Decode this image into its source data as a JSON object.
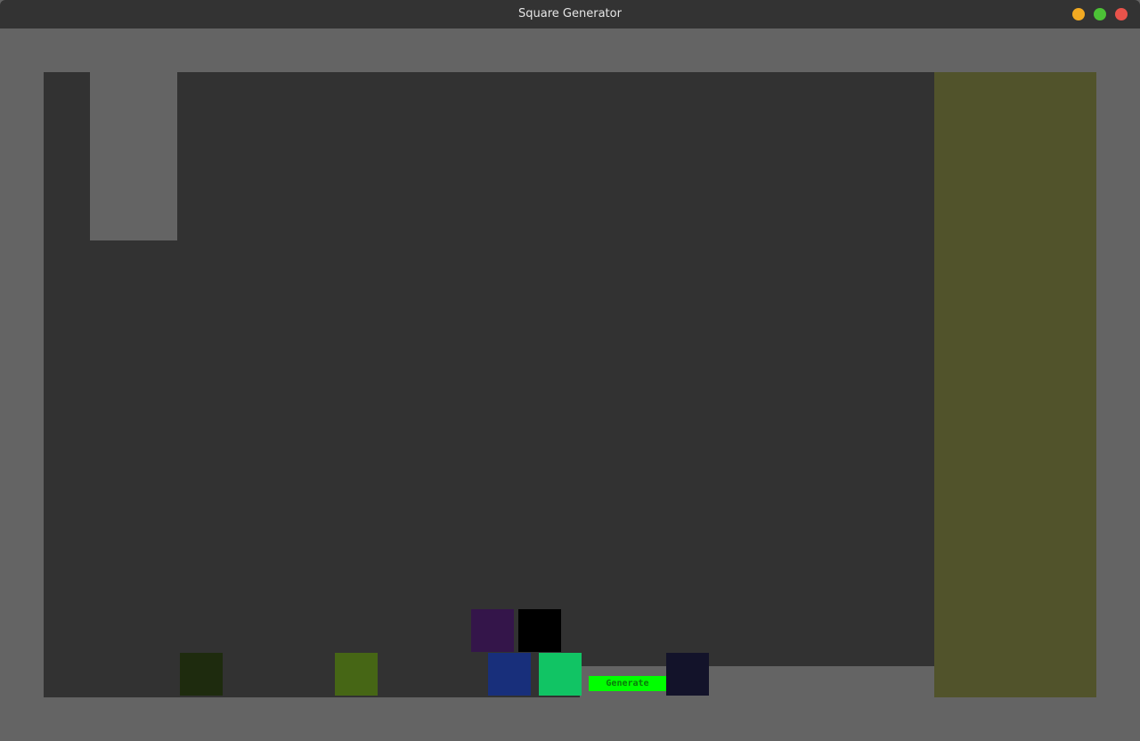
{
  "window": {
    "title": "Square Generator",
    "controls": {
      "minimize_color": "#f2aa22",
      "maximize_color": "#4cc236",
      "close_color": "#e8534b"
    }
  },
  "game": {
    "background_color": "#646464",
    "play_area_color": "#323232",
    "side_panel_color": "#51532b",
    "generate_button": {
      "label": "Generate",
      "background": "#00ff00",
      "text_color": "#0a7a0a"
    },
    "squares": [
      {
        "name": "square-dark-green",
        "color": "#1e2b0e"
      },
      {
        "name": "square-olive",
        "color": "#466615"
      },
      {
        "name": "square-purple",
        "color": "#34154a"
      },
      {
        "name": "square-black",
        "color": "#000000"
      },
      {
        "name": "square-blue",
        "color": "#182f7b"
      },
      {
        "name": "square-green",
        "color": "#11c464"
      },
      {
        "name": "square-navy",
        "color": "#13132a"
      }
    ]
  }
}
